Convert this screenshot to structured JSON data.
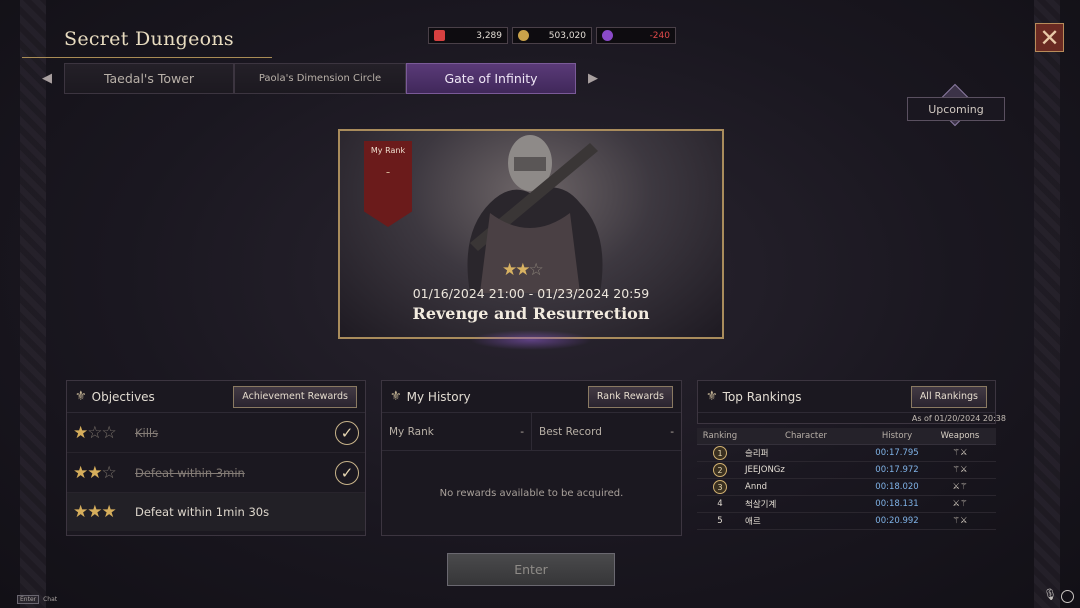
{
  "title": "Secret Dungeons",
  "currency": [
    {
      "icon": "ticket-icon",
      "value": "3,289",
      "color": "#d64040"
    },
    {
      "icon": "gold-coin-icon",
      "value": "503,020",
      "color": "#c9a24a"
    },
    {
      "icon": "corruption-icon",
      "value": "-240",
      "color": "#8a4ac8"
    }
  ],
  "tabs": [
    {
      "label": "Taedal's Tower",
      "active": false
    },
    {
      "label": "Paola's Dimension Circle",
      "active": false
    },
    {
      "label": "Gate of Infinity",
      "active": true
    }
  ],
  "upcoming_label": "Upcoming",
  "banner": {
    "my_rank_label": "My Rank",
    "my_rank_value": "-",
    "stars_filled": 2,
    "stars_total": 3,
    "date_range": "01/16/2024 21:00 - 01/23/2024 20:59",
    "name": "Revenge and Resurrection"
  },
  "objectives": {
    "title": "Objectives",
    "button": "Achievement Rewards",
    "items": [
      {
        "stars": 1,
        "text": "Kills",
        "completed": true
      },
      {
        "stars": 2,
        "text": "Defeat within 3min",
        "completed": true
      },
      {
        "stars": 3,
        "text": "Defeat within 1min 30s",
        "completed": false
      }
    ]
  },
  "history": {
    "title": "My History",
    "button": "Rank Rewards",
    "my_rank_label": "My Rank",
    "my_rank_value": "-",
    "best_record_label": "Best Record",
    "best_record_value": "-",
    "empty_message": "No rewards available to be acquired."
  },
  "rankings": {
    "title": "Top Rankings",
    "button": "All Rankings",
    "as_of": "As of 01/20/2024 20:38",
    "columns": [
      "Ranking",
      "Character",
      "History",
      "Weapons"
    ],
    "rows": [
      {
        "rank": "1",
        "character": "슬리퍼",
        "time": "00:17.795",
        "weapons": "⚚⚔"
      },
      {
        "rank": "2",
        "character": "JEEJONGz",
        "time": "00:17.972",
        "weapons": "⚚⚔"
      },
      {
        "rank": "3",
        "character": "Annd",
        "time": "00:18.020",
        "weapons": "⚔⚚"
      },
      {
        "rank": "4",
        "character": "척살기계",
        "time": "00:18.131",
        "weapons": "⚔⚚"
      },
      {
        "rank": "5",
        "character": "애르",
        "time": "00:20.992",
        "weapons": "⚚⚔"
      }
    ]
  },
  "enter_label": "Enter",
  "chat_key": "Enter",
  "chat_label": "Chat"
}
